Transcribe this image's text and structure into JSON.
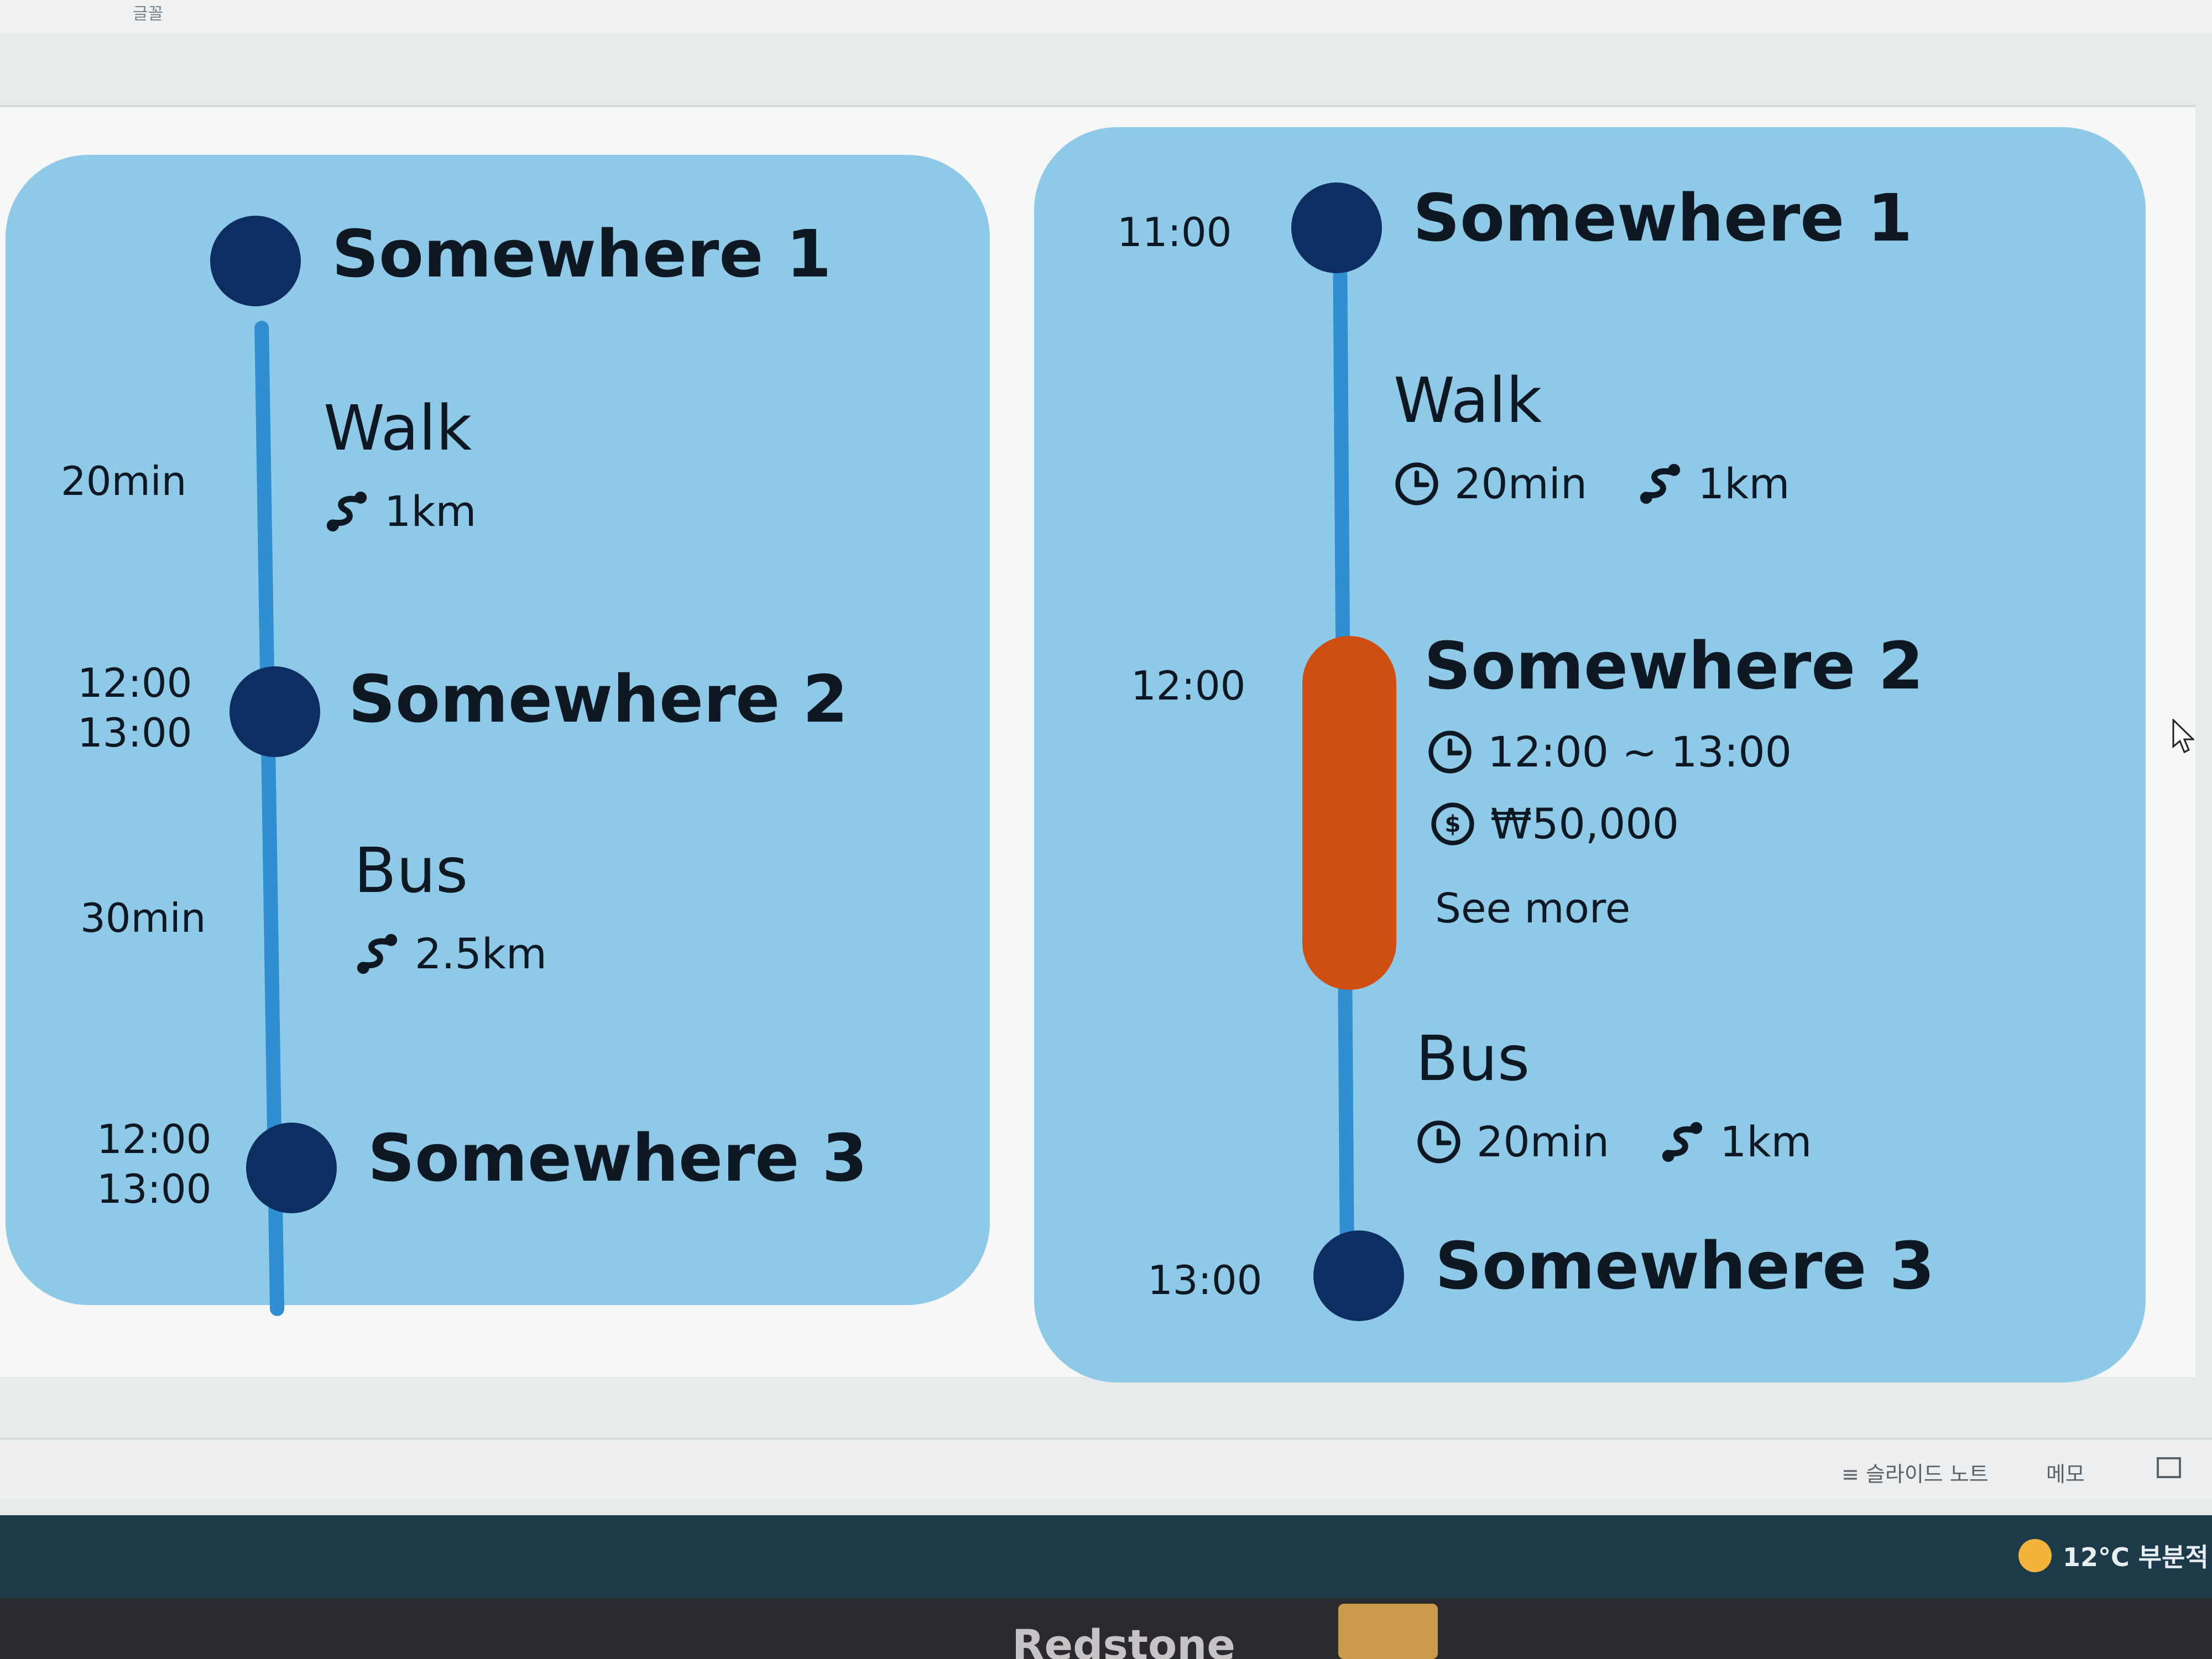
{
  "window": {
    "ribbon_label": "글꼴"
  },
  "left_card": {
    "stops": [
      {
        "name": "Somewhere 1",
        "times": []
      },
      {
        "name": "Somewhere 2",
        "times": [
          "12:00",
          "13:00"
        ]
      },
      {
        "name": "Somewhere 3",
        "times": [
          "12:00",
          "13:00"
        ]
      }
    ],
    "legs": [
      {
        "mode": "Walk",
        "duration": "20min",
        "distance": "1km"
      },
      {
        "mode": "Bus",
        "duration": "30min",
        "distance": "2.5km"
      }
    ]
  },
  "right_card": {
    "stops": [
      {
        "name": "Somewhere 1",
        "time": "11:00"
      },
      {
        "name": "Somewhere 2",
        "time": "12:00",
        "hours": "12:00 ~ 13:00",
        "price": "₩50,000",
        "see_more": "See more"
      },
      {
        "name": "Somewhere 3",
        "time": "13:00"
      }
    ],
    "legs": [
      {
        "mode": "Walk",
        "duration": "20min",
        "distance": "1km"
      },
      {
        "mode": "Bus",
        "duration": "20min",
        "distance": "1km"
      }
    ],
    "colors": {
      "selected_stop": "#cf4f12"
    }
  },
  "colors": {
    "card_bg": "#8fc9e8",
    "node": "#0c2e62",
    "line": "#2f8fd0"
  },
  "status_bar": {
    "slide_notes": "≡ 슬라이드 노트",
    "comments": "메모"
  },
  "taskbar": {
    "weather": "12°C 부분적"
  },
  "background_window": {
    "label": "Redstone"
  }
}
